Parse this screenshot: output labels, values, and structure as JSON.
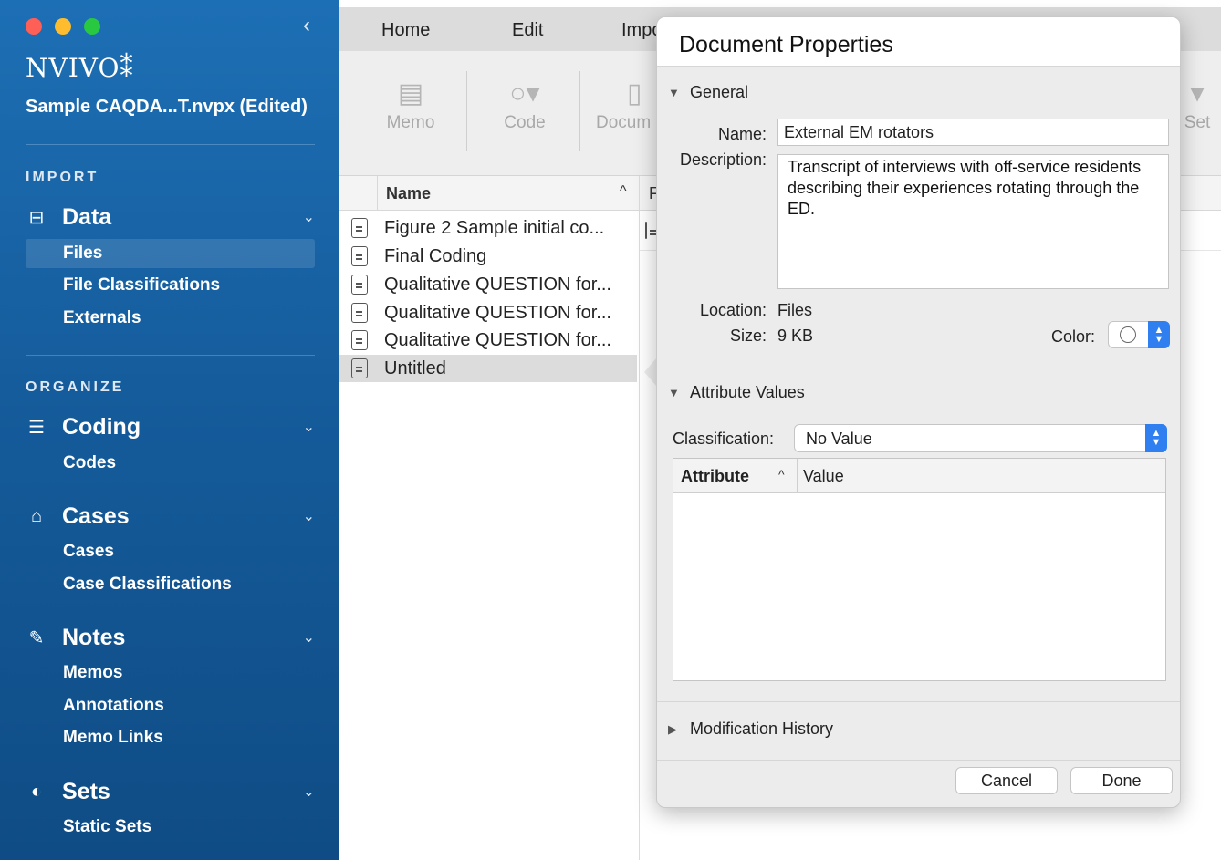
{
  "sidebar": {
    "logo": "NVIVO⁑",
    "project_name": "Sample CAQDA...T.nvpx (Edited)",
    "collapse_glyph": "‹",
    "sections": [
      {
        "label": "IMPORT"
      },
      {
        "label": "ORGANIZE"
      }
    ],
    "groups": [
      {
        "label": "Data",
        "icon": "data-icon",
        "chevron": "⌄",
        "items": [
          "Files",
          "File Classifications",
          "Externals"
        ]
      },
      {
        "label": "Coding",
        "icon": "coding-icon",
        "chevron": "⌄",
        "items": [
          "Codes"
        ]
      },
      {
        "label": "Cases",
        "icon": "cases-icon",
        "chevron": "⌄",
        "items": [
          "Cases",
          "Case Classifications"
        ]
      },
      {
        "label": "Notes",
        "icon": "notes-icon",
        "chevron": "⌄",
        "items": [
          "Memos",
          "Annotations",
          "Memo Links"
        ]
      },
      {
        "label": "Sets",
        "icon": "sets-icon",
        "chevron": "⌄",
        "items": [
          "Static Sets"
        ]
      }
    ],
    "selected_item": "Files"
  },
  "tabs": [
    "Home",
    "Edit",
    "Impo"
  ],
  "toolbar": {
    "memo": "Memo",
    "code": "Code",
    "document": "Docum",
    "set": "Set"
  },
  "file_list": {
    "header_name": "Name",
    "sort_glyph": "^",
    "rows": [
      "Figure 2 Sample initial co...",
      "Final Coding",
      "Qualitative QUESTION for...",
      "Qualitative QUESTION for...",
      "Qualitative QUESTION for...",
      "Untitled"
    ],
    "selected_row": "Untitled",
    "right_header_letter": "F"
  },
  "dialog": {
    "title": "Document Properties",
    "general": {
      "heading": "General",
      "name_label": "Name:",
      "name_value": "External EM rotators",
      "description_label": "Description:",
      "description_value": "Transcript of interviews with off-service residents describing their experiences rotating through the ED.",
      "location_label": "Location:",
      "location_value": "Files",
      "size_label": "Size:",
      "size_value": "9 KB",
      "color_label": "Color:"
    },
    "attributes": {
      "heading": "Attribute Values",
      "classification_label": "Classification:",
      "classification_value": "No Value",
      "col_attribute": "Attribute",
      "col_value": "Value",
      "sort_glyph": "^"
    },
    "history": {
      "heading": "Modification History"
    },
    "cancel_label": "Cancel",
    "done_label": "Done"
  }
}
